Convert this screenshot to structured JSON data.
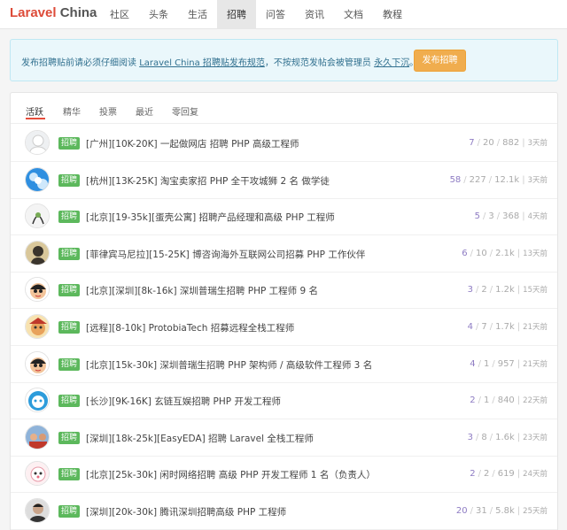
{
  "brand": {
    "part1": "Laravel",
    "part2": "China"
  },
  "nav": {
    "items": [
      "社区",
      "头条",
      "生活",
      "招聘",
      "问答",
      "资讯",
      "文档",
      "教程"
    ],
    "active": "招聘"
  },
  "notice": {
    "prefix": "发布招聘贴前请必须仔细阅读",
    "rules_link": "Laravel China 招聘贴发布规范",
    "middle": "，不按规范发帖会被管理员",
    "ban_link": "永久下沉",
    "suffix": "。",
    "button_label": "发布招聘"
  },
  "filters": [
    "活跃",
    "精华",
    "投票",
    "最近",
    "零回复"
  ],
  "badge_label": "招聘",
  "colors": {
    "brand_red": "#dd4b39",
    "badge_green": "#5cb85c",
    "button_orange": "#f0ad4e",
    "reply_count_purple": "#8e7cc3"
  },
  "topics": [
    {
      "avatar": "white-figure-avatar",
      "title": "[广州][10K-20K] 一起做网店 招聘 PHP 高级工程师",
      "replies": "7",
      "votes": "20",
      "views": "882",
      "ago": "3天前"
    },
    {
      "avatar": "blue-sky-avatar",
      "title": "[杭州][13K-25K] 淘宝卖家招 PHP 全干攻城狮 2 名 做学徒",
      "replies": "58",
      "votes": "227",
      "views": "12.1k",
      "ago": "3天前"
    },
    {
      "avatar": "sketch-avatar",
      "title": "[北京][19-35k][蛋壳公寓] 招聘产品经理和高级 PHP 工程师",
      "replies": "5",
      "votes": "3",
      "views": "368",
      "ago": "4天前"
    },
    {
      "avatar": "dark-figure-avatar",
      "title": "[菲律宾马尼拉][15-25K] 博咨询海外互联网公司招募 PHP 工作伙伴",
      "replies": "6",
      "votes": "10",
      "views": "2.1k",
      "ago": "13天前"
    },
    {
      "avatar": "cartoon-boy-avatar",
      "title": "[北京][深圳][8k-16k] 深圳普瑞生招聘 PHP 工程师 9 名",
      "replies": "3",
      "votes": "2",
      "views": "1.2k",
      "ago": "15天前"
    },
    {
      "avatar": "colorful-avatar",
      "title": "[远程][8-10k] ProtobiaTech 招募远程全栈工程师",
      "replies": "4",
      "votes": "7",
      "views": "1.7k",
      "ago": "21天前"
    },
    {
      "avatar": "cartoon-boy-avatar",
      "title": "[北京][15k-30k] 深圳普瑞生招聘 PHP 架构师 / 高级软件工程师 3 名",
      "replies": "4",
      "votes": "1",
      "views": "957",
      "ago": "21天前"
    },
    {
      "avatar": "blue-robot-avatar",
      "title": "[长沙][9K-16K] 玄链互娱招聘 PHP 开发工程师",
      "replies": "2",
      "votes": "1",
      "views": "840",
      "ago": "22天前"
    },
    {
      "avatar": "group-photo-avatar",
      "title": "[深圳][18k-25k][EasyEDA] 招聘 Laravel 全栈工程师",
      "replies": "3",
      "votes": "8",
      "views": "1.6k",
      "ago": "23天前"
    },
    {
      "avatar": "pink-cartoon-avatar",
      "title": "[北京][25k-30k] 闲时网络招聘 高级 PHP 开发工程师 1 名（负责人）",
      "replies": "2",
      "votes": "2",
      "views": "619",
      "ago": "24天前"
    },
    {
      "avatar": "portrait-avatar",
      "title": "[深圳][20k-30k] 腾讯深圳招聘高级 PHP 工程师",
      "replies": "20",
      "votes": "31",
      "views": "5.8k",
      "ago": "25天前"
    }
  ]
}
